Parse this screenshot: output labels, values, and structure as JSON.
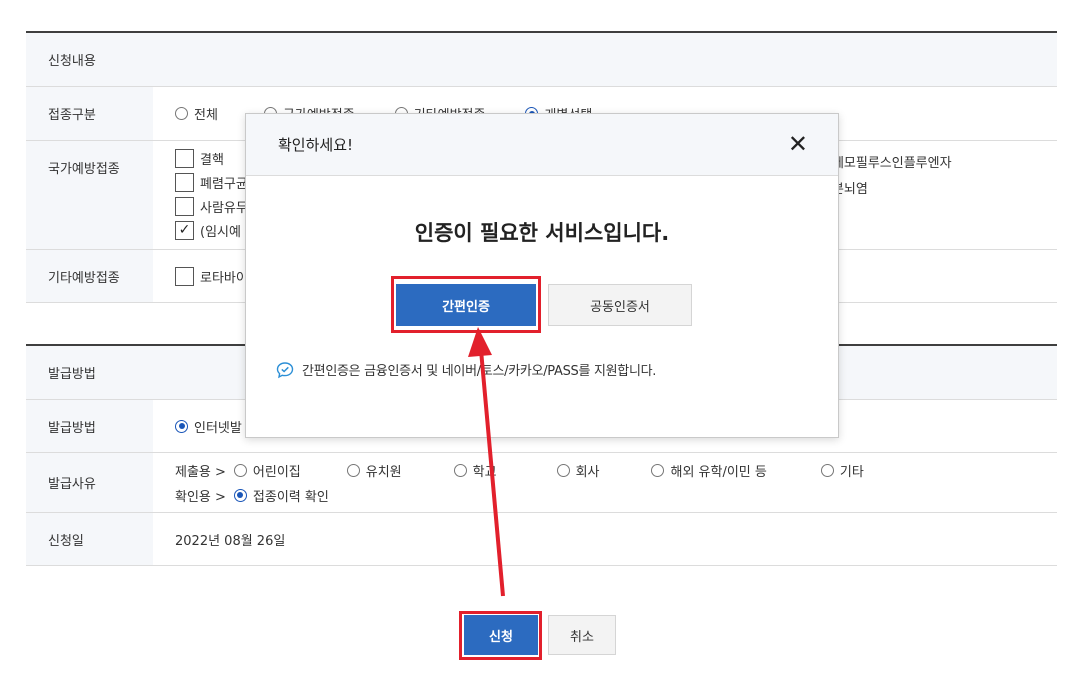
{
  "section1": {
    "title": "신청내용",
    "rows": {
      "vaccine_type": {
        "label": "접종구분",
        "options": [
          "전체",
          "국가예방접종",
          "기타예방접종",
          "개별선택"
        ],
        "selected": "개별선택"
      },
      "national": {
        "label": "국가예방접종",
        "checkboxes": [
          "결핵",
          "폐렴구균",
          "사람유두",
          "(임시예"
        ],
        "checked": [
          "(임시예"
        ],
        "right_texts": [
          "형헤모필루스인플루엔자",
          "일본뇌염"
        ]
      },
      "other": {
        "label": "기타예방접종",
        "checkboxes": [
          "로타바이"
        ]
      }
    }
  },
  "section2": {
    "title": "발급방법",
    "rows": {
      "method": {
        "label": "발급방법",
        "option": "인터넷발"
      },
      "reason": {
        "label": "발급사유",
        "submit_prefix": "제출용 >",
        "submit_options": [
          "어린이집",
          "유치원",
          "학교",
          "회사",
          "해외 유학/이민 등",
          "기타"
        ],
        "confirm_prefix": "확인용 >",
        "confirm_option": "접종이력 확인"
      },
      "date": {
        "label": "신청일",
        "value": "2022년 08월 26일"
      }
    }
  },
  "footer": {
    "apply_label": "신청",
    "cancel_label": "취소"
  },
  "modal": {
    "title": "확인하세요!",
    "close_icon": "close-icon",
    "message": "인증이 필요한 서비스입니다.",
    "simple_auth_label": "간편인증",
    "cert_label": "공동인증서",
    "info_text": "간편인증은 금융인증서 및 네이버/토스/카카오/PASS를 지원합니다.",
    "info_icon": "chat-check-icon"
  },
  "colors": {
    "primary": "#2c6bc0",
    "highlight": "#e2202c"
  }
}
